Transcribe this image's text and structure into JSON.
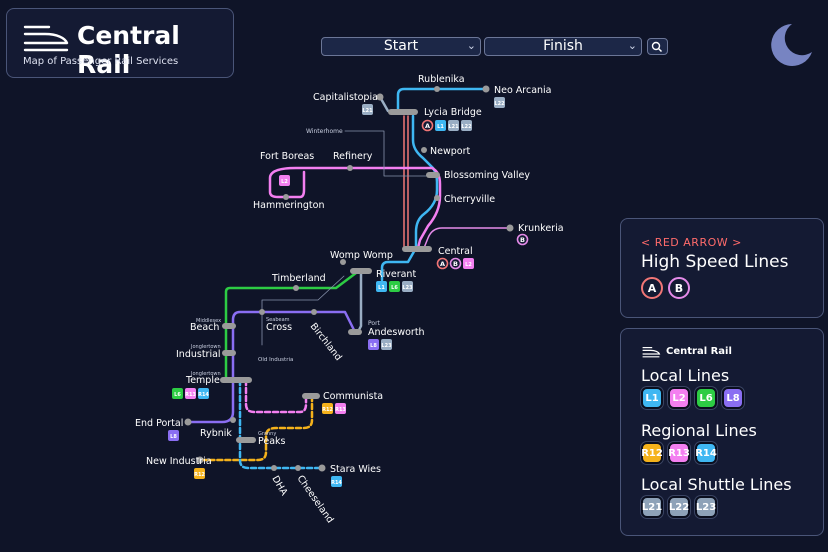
{
  "app": {
    "title": "Central Rail",
    "subtitle": "Map of Passenger Rail Services"
  },
  "route": {
    "start_label": "Start",
    "finish_label": "Finish"
  },
  "icons": {
    "logo": "train-icon",
    "search": "search-icon",
    "theme": "moon-icon",
    "chevron": "chevron-down-icon"
  },
  "colors": {
    "background": "#0f1428",
    "red_arrow": "#ff6b6b",
    "L1": "#3fb7f2",
    "L2": "#f37ff0",
    "L6": "#2dcc44",
    "L8": "#8a6ef2",
    "R12": "#f5b21b",
    "R13": "#f37ff0",
    "R14": "#3fb7f2",
    "shuttle": "#9aaec4",
    "hs_A": "#f27676",
    "hs_B": "#e58be9"
  },
  "high_speed": {
    "supertitle": "< RED ARROW >",
    "heading": "High Speed Lines",
    "lines": [
      "A",
      "B"
    ]
  },
  "legend": {
    "brand": "Central Rail",
    "local_heading": "Local Lines",
    "local": [
      "L1",
      "L2",
      "L6",
      "L8"
    ],
    "regional_heading": "Regional Lines",
    "regional": [
      "R12",
      "R13",
      "R14"
    ],
    "shuttle_heading": "Local Shuttle Lines",
    "shuttle": [
      "L21",
      "L22",
      "L23"
    ]
  },
  "map": {
    "stations": {
      "capitalistopia": "Capitalistopia",
      "rublenika": "Rublenika",
      "neo_arcania": "Neo Arcania",
      "lycia_bridge": "Lycia Bridge",
      "winterhome": "Winterhome",
      "newport": "Newport",
      "fort_boreas": "Fort Boreas",
      "refinery": "Refinery",
      "blossoming_valley": "Blossoming Valley",
      "hammerington": "Hammerington",
      "cherryville": "Cherryville",
      "krunkeria": "Krunkeria",
      "womp_womp": "Womp Womp",
      "central": "Central",
      "timberland": "Timberland",
      "riverant": "Riverant",
      "middlesex": "Middlesex",
      "beach": "Beach",
      "cross_small": "Seabeam",
      "cross": "Cross",
      "birchland": "Birchland",
      "andesworth_small": "Port",
      "andesworth": "Andesworth",
      "industrial_small": "Jonglertown",
      "industrial": "Industrial",
      "old_industria": "Old Industria",
      "temple_small": "Jonglertown",
      "temple": "Temple",
      "communista": "Communista",
      "end_portal": "End Portal",
      "rybnik": "Rybnik",
      "peaks_small": "Granny",
      "peaks": "Peaks",
      "new_industria": "New Industria",
      "stara_wies": "Stara Wies",
      "dha": "DHA",
      "cheeseland": "Cheeseland"
    },
    "badges": {
      "capitalistopia": [
        "L21"
      ],
      "neo_arcania": [
        "L22"
      ],
      "lycia_bridge": [
        "A",
        "L1",
        "L21",
        "L22"
      ],
      "fort_boreas": [
        "L2"
      ],
      "krunkeria": [
        "B"
      ],
      "central": [
        "A",
        "B",
        "L2"
      ],
      "riverant": [
        "L1",
        "L6",
        "L23"
      ],
      "andesworth": [
        "L8",
        "L23"
      ],
      "temple": [
        "L6",
        "R13",
        "R14"
      ],
      "communista": [
        "R12",
        "R13"
      ],
      "end_portal": [
        "L8"
      ],
      "new_industria": [
        "R12"
      ],
      "stara_wies": [
        "R14"
      ]
    }
  }
}
